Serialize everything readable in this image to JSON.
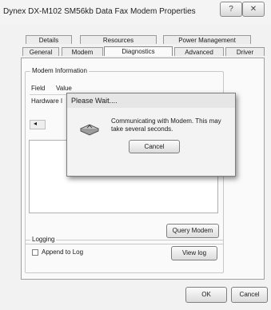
{
  "window": {
    "title": "Dynex DX-M102 SM56kb Data Fax Modem Properties",
    "help_icon": "?",
    "close_icon": "✕"
  },
  "tabs_row1": [
    "Details",
    "Resources",
    "Power Management"
  ],
  "tabs_row2": [
    "General",
    "Modem",
    "Diagnostics",
    "Advanced",
    "Driver"
  ],
  "active_tab": "Diagnostics",
  "modem_info": {
    "group_label": "Modem Information",
    "col_field": "Field",
    "col_value": "Value",
    "row1_field": "Hardware I"
  },
  "query_modem_label": "Query Modem",
  "logging": {
    "group_label": "Logging",
    "append_label": "Append to Log",
    "append_checked": false,
    "view_log_label": "View log"
  },
  "footer": {
    "ok_label": "OK",
    "cancel_label": "Cancel"
  },
  "wait_dialog": {
    "title": "Please Wait....",
    "message": "Communicating with Modem. This may take several seconds.",
    "cancel_label": "Cancel"
  }
}
